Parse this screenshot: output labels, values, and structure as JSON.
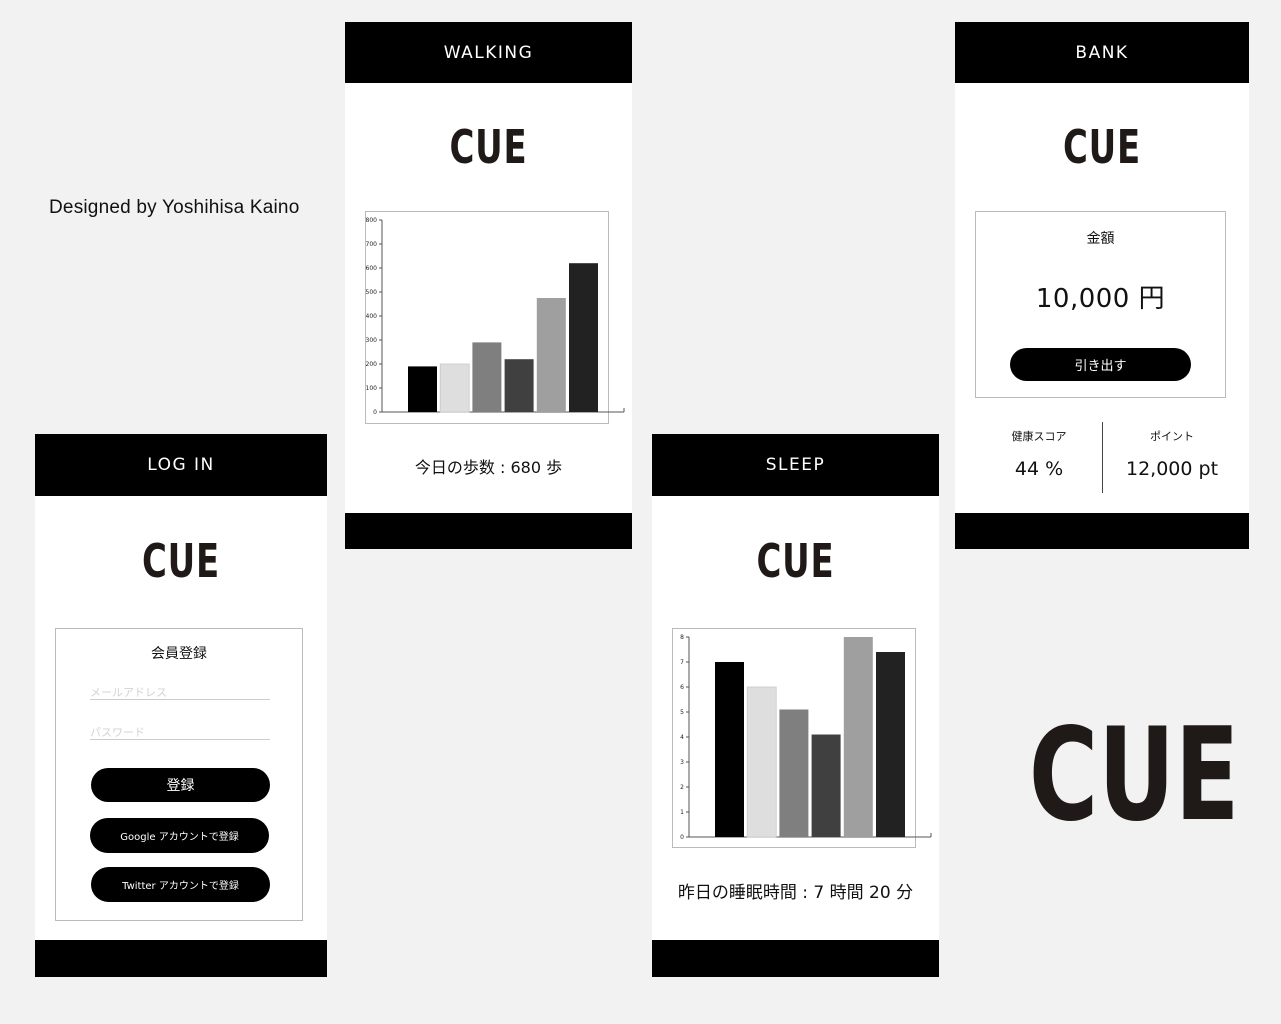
{
  "credit": "Designed by Yoshihisa Kaino",
  "logo": "CUE",
  "big_logo": "CUE",
  "login": {
    "header": "LOG IN",
    "form_title": "会員登録",
    "email_placeholder": "メールアドレス",
    "password_placeholder": "パスワード",
    "register_button": "登録",
    "google_button": "Google アカウントで登録",
    "twitter_button": "Twitter アカウントで登録"
  },
  "walking": {
    "header": "WALKING",
    "caption": "今日の歩数 : 680 歩"
  },
  "sleep": {
    "header": "SLEEP",
    "caption": "昨日の睡眠時間 : 7 時間 20 分"
  },
  "bank": {
    "header": "BANK",
    "amount_label": "金額",
    "amount_value": "10,000 円",
    "withdraw_button": "引き出す",
    "health_label": "健康スコア",
    "health_value": "44 %",
    "points_label": "ポイント",
    "points_value": "12,000 pt"
  },
  "chart_data": [
    {
      "type": "bar",
      "values": [
        190,
        200,
        290,
        220,
        475,
        620
      ],
      "ylim": [
        0,
        800
      ],
      "yticks": [
        "0",
        "100",
        "200",
        "300",
        "400",
        "500",
        "600",
        "700",
        "800"
      ],
      "colors": [
        "#000000",
        "#dedede",
        "#7f7f7f",
        "#404040",
        "#9f9f9f",
        "#222222"
      ],
      "grid": false
    },
    {
      "type": "bar",
      "values": [
        7,
        6,
        5.1,
        4.1,
        8,
        7.4
      ],
      "ylim": [
        0,
        8
      ],
      "yticks": [
        "0",
        "1",
        "2",
        "3",
        "4",
        "5",
        "6",
        "7",
        "8"
      ],
      "colors": [
        "#000000",
        "#dedede",
        "#7f7f7f",
        "#404040",
        "#9f9f9f",
        "#222222"
      ],
      "grid": false
    }
  ]
}
